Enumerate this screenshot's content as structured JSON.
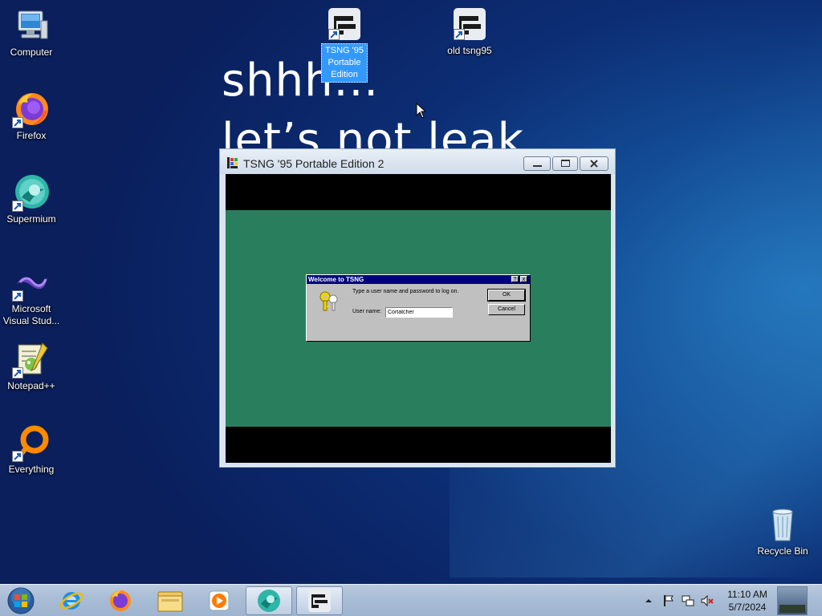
{
  "desktop": {
    "icons": [
      {
        "label": "Computer",
        "icon": "computer-icon"
      },
      {
        "label": "Firefox",
        "icon": "firefox-icon"
      },
      {
        "label": "Supermium",
        "icon": "supermium-icon"
      },
      {
        "label": "Microsoft Visual Stud...",
        "icon": "visual-studio-icon"
      },
      {
        "label": "Notepad++",
        "icon": "notepad-plus-plus-icon"
      },
      {
        "label": "Everything",
        "icon": "everything-icon"
      },
      {
        "label": "TSNG '95 Portable Edition",
        "icon": "tsng-icon"
      },
      {
        "label": "old tsng95",
        "icon": "tsng-icon"
      },
      {
        "label": "Recycle Bin",
        "icon": "recycle-bin-icon"
      }
    ],
    "wallpaper_text": [
      "shhh...",
      "let’s not leak"
    ]
  },
  "window": {
    "title": "TSNG '95 Portable Edition 2",
    "dialog": {
      "title": "Welcome to TSNG",
      "prompt": "Type a user name and password to log on.",
      "user_label": "User name:",
      "user_value": "Cortatcher",
      "ok_label": "OK",
      "cancel_label": "Cancel",
      "help_label": "?",
      "close_label": "x"
    }
  },
  "taskbar": {
    "pinned": [
      "internet-explorer-icon",
      "firefox-icon",
      "explorer-icon",
      "media-player-icon",
      "supermium-icon",
      "tsng-icon"
    ],
    "time": "11:10 AM",
    "date": "5/7/2024",
    "tray_icons": [
      "show-hidden-icons",
      "action-center-flag-icon",
      "network-icon",
      "volume-muted-icon"
    ]
  },
  "colors": {
    "dialog_green": "#297e5d",
    "win95_titlebar": "#00007f",
    "selection": "#3399ff"
  }
}
